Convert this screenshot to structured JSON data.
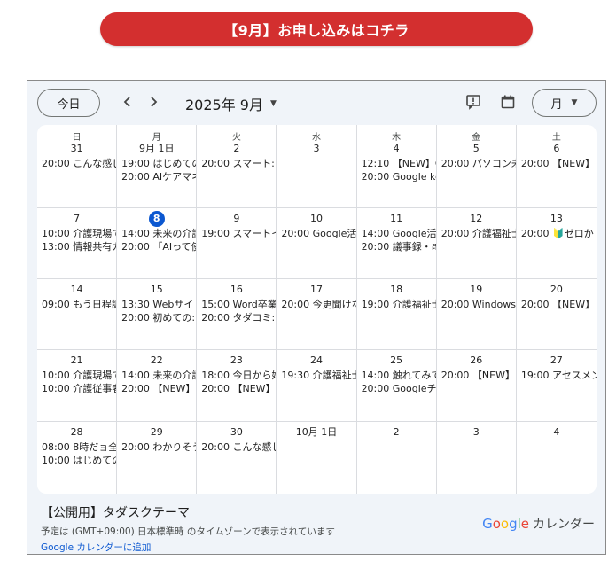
{
  "banner": {
    "label": "【9月】お申し込みはコチラ",
    "color": "#d32f2f"
  },
  "toolbar": {
    "today_label": "今日",
    "prev_icon": "chevron-left-icon",
    "next_icon": "chevron-right-icon",
    "month_title": "2025年 9月",
    "view_label": "月"
  },
  "weekdays": [
    "日",
    "月",
    "火",
    "水",
    "木",
    "金",
    "土"
  ],
  "weeks": [
    [
      {
        "day": "31",
        "events": [
          "20:00 こんな感じ"
        ]
      },
      {
        "day": "9月 1日",
        "events": [
          "19:00 はじめての",
          "20:00 AIケアマネ"
        ]
      },
      {
        "day": "2",
        "events": [
          "20:00 スマート:"
        ]
      },
      {
        "day": "3",
        "events": []
      },
      {
        "day": "4",
        "events": [
          "12:10 【NEW】G",
          "20:00 Google ke"
        ]
      },
      {
        "day": "5",
        "events": [
          "20:00 パソコン未"
        ]
      },
      {
        "day": "6",
        "events": [
          "20:00 【NEW】"
        ]
      }
    ],
    [
      {
        "day": "7",
        "events": [
          "10:00 介護現場で",
          "13:00 情報共有ガ"
        ]
      },
      {
        "day": "8",
        "today": true,
        "events": [
          "14:00 未来の介護",
          "20:00 「AIって使"
        ]
      },
      {
        "day": "9",
        "events": [
          "19:00 スマートイ"
        ]
      },
      {
        "day": "10",
        "events": [
          "20:00 Google活"
        ]
      },
      {
        "day": "11",
        "events": [
          "14:00 Google活",
          "20:00 議事録・គ"
        ]
      },
      {
        "day": "12",
        "events": [
          "20:00 介護福祉士"
        ]
      },
      {
        "day": "13",
        "events": [
          "20:00 🔰ゼロか"
        ]
      }
    ],
    [
      {
        "day": "14",
        "events": [
          "09:00 もう日程調"
        ]
      },
      {
        "day": "15",
        "events": [
          "13:30 Webサイト",
          "20:00 初めての:"
        ]
      },
      {
        "day": "16",
        "events": [
          "15:00 Word卒業",
          "20:00 タダコミ:"
        ]
      },
      {
        "day": "17",
        "events": [
          "20:00 今更聞けな"
        ]
      },
      {
        "day": "18",
        "events": [
          "19:00 介護福祉士"
        ]
      },
      {
        "day": "19",
        "events": [
          "20:00 Windows"
        ]
      },
      {
        "day": "20",
        "events": [
          "20:00 【NEW】"
        ]
      }
    ],
    [
      {
        "day": "21",
        "events": [
          "10:00 介護現場で",
          "10:00 介護従事者"
        ]
      },
      {
        "day": "22",
        "events": [
          "14:00 未来の介護",
          "20:00 【NEW】"
        ]
      },
      {
        "day": "23",
        "events": [
          "18:00 今日から始",
          "20:00 【NEW】"
        ]
      },
      {
        "day": "24",
        "events": [
          "19:30 介護福祉士"
        ]
      },
      {
        "day": "25",
        "events": [
          "14:00 触れてみて",
          "20:00 Googleチ"
        ]
      },
      {
        "day": "26",
        "events": [
          "20:00 【NEW】"
        ]
      },
      {
        "day": "27",
        "events": [
          "19:00 アセスメン"
        ]
      }
    ],
    [
      {
        "day": "28",
        "events": [
          "08:00 8時だョ全",
          "10:00 はじめての"
        ]
      },
      {
        "day": "29",
        "events": [
          "20:00 わかりそう"
        ]
      },
      {
        "day": "30",
        "events": [
          "20:00 こんな感じ"
        ]
      },
      {
        "day": "10月 1日",
        "events": []
      },
      {
        "day": "2",
        "events": []
      },
      {
        "day": "3",
        "events": []
      },
      {
        "day": "4",
        "events": []
      }
    ]
  ],
  "footer": {
    "calendar_name": "【公開用】タダスクテーマ",
    "tz_note": "予定は (GMT+09:00) 日本標準時 のタイムゾーンで表示されています",
    "add_link": "Google カレンダーに追加",
    "brand_google": "Google",
    "brand_calendar": "カレンダー"
  },
  "colors": {
    "accent": "#0b57d0",
    "banner": "#d32f2f",
    "frame_bg": "#f0f4f9"
  }
}
